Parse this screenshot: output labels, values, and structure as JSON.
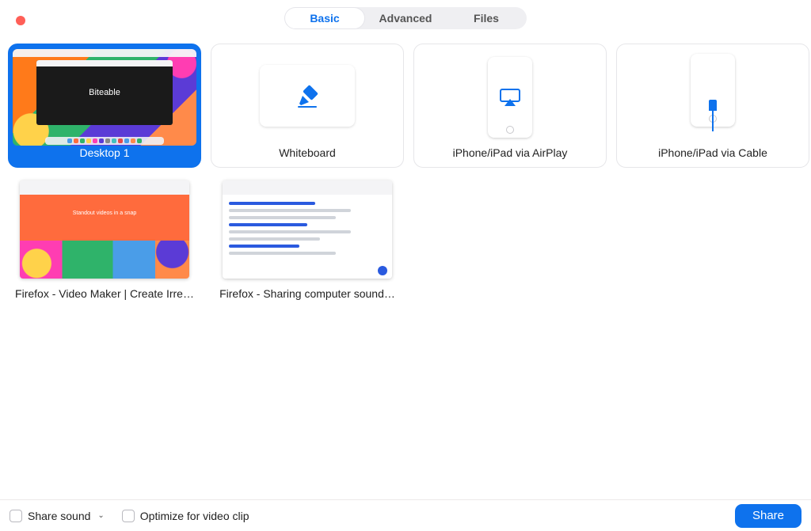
{
  "tabs": {
    "basic": "Basic",
    "advanced": "Advanced",
    "files": "Files",
    "active": "basic"
  },
  "tiles": {
    "desktop1": {
      "label": "Desktop 1",
      "preview_text": "Biteable"
    },
    "whiteboard": {
      "label": "Whiteboard"
    },
    "airplay": {
      "label": "iPhone/iPad via AirPlay"
    },
    "cable": {
      "label": "iPhone/iPad via Cable"
    },
    "ff1": {
      "label": "Firefox - Video Maker | Create Irre…"
    },
    "ff2": {
      "label": "Firefox - Sharing computer sound…"
    }
  },
  "footer": {
    "share_sound": "Share sound",
    "optimize": "Optimize for video clip",
    "share_btn": "Share"
  },
  "colors": {
    "accent": "#0e72ed"
  }
}
